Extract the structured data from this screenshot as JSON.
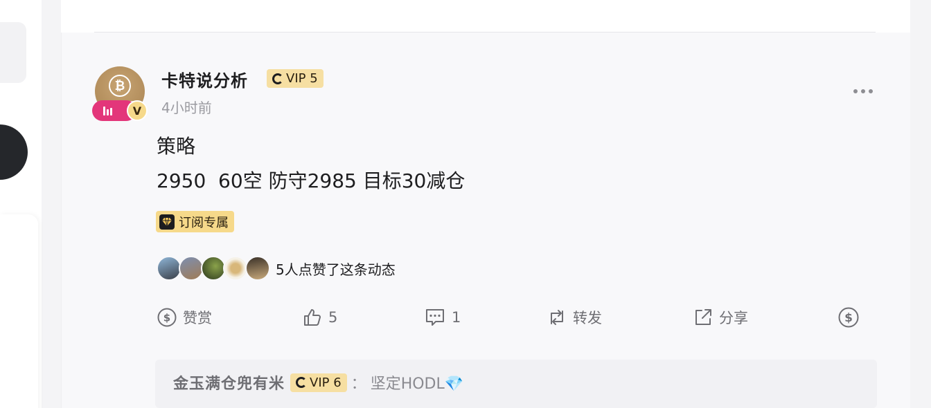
{
  "post": {
    "author": "卡特说分析",
    "author_vip": "VIP 5",
    "time": "4小时前",
    "title": "策略",
    "body": "2950  60空 防守2985 目标30减仓",
    "tag": "订阅专属",
    "likes_summary": "5人点赞了这条动态"
  },
  "actions": {
    "tip_label": "赞赏",
    "like_count": "5",
    "comment_count": "1",
    "repost_label": "转发",
    "share_label": "分享"
  },
  "comment": {
    "author": "金玉满仓兜有米",
    "vip": "VIP 6",
    "separator": "：",
    "text": "坚定HODL💎"
  },
  "colors": {
    "accent_gold": "#f6d98a",
    "live_pink": "#e3367a",
    "muted_text": "#9a9aa0"
  }
}
